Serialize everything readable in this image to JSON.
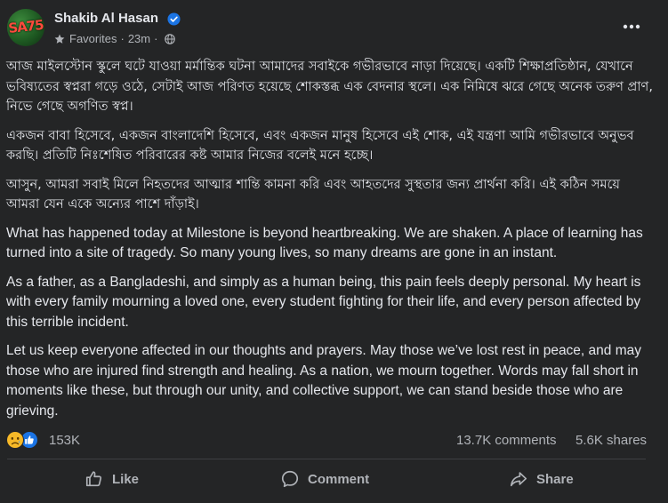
{
  "post": {
    "author": "Shakib Al Hasan",
    "avatar_label": "SA75",
    "audience": "Favorites",
    "time": "23m",
    "separator": "·",
    "icons": [
      "verified-badge-icon",
      "star-icon",
      "globe-icon",
      "more-options-icon"
    ],
    "paragraphs": [
      "আজ মাইলস্টোন স্কুলে ঘটে যাওয়া মর্মান্তিক ঘটনা আমাদের সবাইকে গভীরভাবে নাড়া দিয়েছে। একটি শিক্ষাপ্রতিষ্ঠান, যেখানে ভবিষ্যতের স্বপ্নরা গড়ে ওঠে, সেটাই আজ পরিণত হয়েছে শোকস্তব্ধ এক বেদনার স্থলে। এক নিমিষে ঝরে গেছে অনেক তরুণ প্রাণ, নিভে গেছে অগণিত স্বপ্ন।",
      "একজন বাবা হিসেবে, একজন বাংলাদেশি হিসেবে, এবং একজন মানুষ হিসেবে এই শোক, এই যন্ত্রণা আমি গভীরভাবে অনুভব করছি। প্রতিটি নিঃশেষিত পরিবারের কষ্ট আমার নিজের বলেই মনে হচ্ছে।",
      "আসুন, আমরা সবাই মিলে নিহতদের আত্মার শান্তি কামনা করি এবং আহতদের সুস্থতার জন্য প্রার্থনা করি। এই কঠিন সময়ে আমরা যেন একে অন্যের পাশে দাঁড়াই।",
      "What has happened today at Milestone is beyond heartbreaking. We are shaken. A place of learning has turned into a site of tragedy. So many young lives, so many dreams are gone in an instant.",
      "As a father, as a Bangladeshi, and simply as a human being, this pain feels deeply personal. My heart is with every family mourning a loved one, every student fighting for their life, and every person affected by this terrible incident.",
      "Let us keep everyone affected in our thoughts and prayers. May those we’ve lost rest in peace, and may those who are injured find strength and healing. As a nation, we mourn together. Words may fall short in moments like these, but through our unity, and collective support, we can stand beside those who are grieving."
    ]
  },
  "stats": {
    "reactions_count": "153K",
    "reaction_icons": [
      "sad-reaction-icon",
      "like-reaction-icon"
    ],
    "comments": "13.7K comments",
    "shares": "5.6K shares"
  },
  "actions": {
    "like": "Like",
    "comment": "Comment",
    "share": "Share",
    "icons": [
      "like-icon",
      "comment-icon",
      "share-icon"
    ]
  },
  "colors": {
    "background": "#242526",
    "text_primary": "#e4e6eb",
    "text_secondary": "#b0b3b8",
    "verified_blue": "#1b74e4",
    "divider": "#3e4042"
  }
}
